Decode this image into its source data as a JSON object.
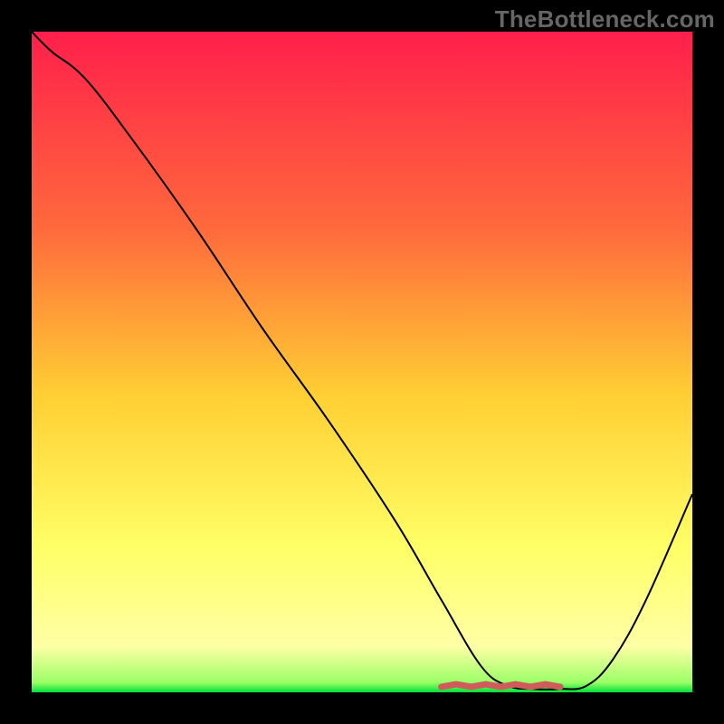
{
  "watermark": "TheBottleneck.com",
  "colors": {
    "gradient_top": "#ff1f4b",
    "gradient_mid_upper": "#ff6a3c",
    "gradient_mid": "#ffcf33",
    "gradient_mid_lower": "#ffff66",
    "gradient_lower": "#ffffa6",
    "gradient_bottom": "#00e03a",
    "curve": "#000000",
    "trough_marker": "#cf5b5b",
    "frame": "#000000"
  },
  "chart_data": {
    "type": "line",
    "title": "",
    "xlabel": "",
    "ylabel": "",
    "xlim": [
      0,
      100
    ],
    "ylim": [
      0,
      100
    ],
    "grid": false,
    "series": [
      {
        "name": "bottleneck-curve",
        "x": [
          0,
          3,
          8,
          15,
          25,
          35,
          45,
          55,
          62,
          68,
          72,
          76,
          80,
          84,
          88,
          93,
          100
        ],
        "y": [
          100,
          97,
          93,
          84,
          70,
          55,
          41,
          26,
          14,
          4,
          1,
          0.5,
          0.5,
          1,
          5,
          14,
          30
        ]
      }
    ],
    "trough_marker": {
      "x0": 62,
      "x1": 80
    },
    "gradient_stops": [
      {
        "offset": 0.0,
        "color": "#ff1f4b"
      },
      {
        "offset": 0.3,
        "color": "#ff6a3c"
      },
      {
        "offset": 0.55,
        "color": "#ffcf33"
      },
      {
        "offset": 0.78,
        "color": "#ffff66"
      },
      {
        "offset": 0.93,
        "color": "#ffffa6"
      },
      {
        "offset": 0.985,
        "color": "#9bff66"
      },
      {
        "offset": 1.0,
        "color": "#00e03a"
      }
    ]
  }
}
